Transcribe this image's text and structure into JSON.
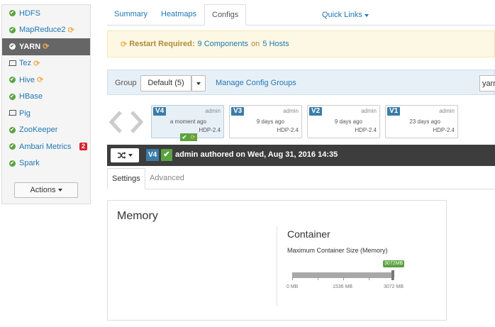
{
  "sidebar": {
    "items": [
      {
        "label": "HDFS",
        "status": "ok",
        "restart": false,
        "alerts": ""
      },
      {
        "label": "MapReduce2",
        "status": "ok",
        "restart": true,
        "alerts": ""
      },
      {
        "label": "YARN",
        "status": "ok",
        "restart": true,
        "alerts": "",
        "active": true
      },
      {
        "label": "Tez",
        "status": "client",
        "restart": true,
        "alerts": ""
      },
      {
        "label": "Hive",
        "status": "ok",
        "restart": true,
        "alerts": ""
      },
      {
        "label": "HBase",
        "status": "ok",
        "restart": false,
        "alerts": ""
      },
      {
        "label": "Pig",
        "status": "client",
        "restart": false,
        "alerts": ""
      },
      {
        "label": "ZooKeeper",
        "status": "ok",
        "restart": false,
        "alerts": ""
      },
      {
        "label": "Ambari Metrics",
        "status": "ok",
        "restart": false,
        "alerts": "2"
      },
      {
        "label": "Spark",
        "status": "ok",
        "restart": false,
        "alerts": ""
      }
    ],
    "actions_label": "Actions"
  },
  "tabs": {
    "summary": "Summary",
    "heatmaps": "Heatmaps",
    "configs": "Configs",
    "quick_links": "Quick Links"
  },
  "restart": {
    "label": "Restart Required:",
    "components": "9 Components",
    "on": "on",
    "hosts": "5 Hosts"
  },
  "group": {
    "label": "Group",
    "selected": "Default (5)",
    "manage_link": "Manage Config Groups",
    "filter_value": "yarn"
  },
  "versions": [
    {
      "badge": "V4",
      "author": "admin",
      "ago": "a moment ago",
      "stack": "HDP-2.4",
      "current": true
    },
    {
      "badge": "V3",
      "author": "admin",
      "ago": "9 days ago",
      "stack": "HDP-2.4",
      "current": false
    },
    {
      "badge": "V2",
      "author": "admin",
      "ago": "9 days ago",
      "stack": "HDP-2.4",
      "current": false
    },
    {
      "badge": "V1",
      "author": "admin",
      "ago": "23 days ago",
      "stack": "HDP-2.4",
      "current": false
    }
  ],
  "authored_bar": {
    "badge": "V4",
    "text": "admin authored on Wed, Aug 31, 2016 14:35"
  },
  "subtabs": {
    "settings": "Settings",
    "advanced": "Advanced"
  },
  "memory": {
    "title": "Memory",
    "section": "Container",
    "field_label": "Maximum Container Size (Memory)",
    "value_label": "3072MB",
    "value": 3072,
    "min": 0,
    "max": 3072,
    "ticks": [
      "0 MB",
      "1536 MB",
      "3072 MB"
    ]
  },
  "colors": {
    "link": "#1f77b4",
    "ok": "#5aa340",
    "restart": "#f0ad4e",
    "alert": "#d9232e",
    "version_badge": "#3a7ca8",
    "dark_bar": "#3d3d3d",
    "restart_bg": "#fcf8e3",
    "group_bg": "#e8f0f7"
  }
}
